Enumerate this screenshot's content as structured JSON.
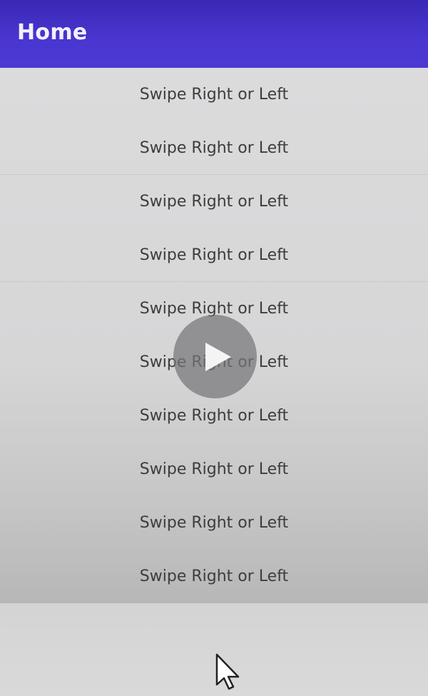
{
  "app_bar": {
    "title": "Home",
    "color": "#4a36d0"
  },
  "list": {
    "items": [
      {
        "label": "Swipe Right or Left"
      },
      {
        "label": "Swipe Right or Left"
      },
      {
        "label": "Swipe Right or Left"
      },
      {
        "label": "Swipe Right or Left"
      },
      {
        "label": "Swipe Right or Left"
      },
      {
        "label": "Swipe Right or Left"
      },
      {
        "label": "Swipe Right or Left"
      },
      {
        "label": "Swipe Right or Left"
      },
      {
        "label": "Swipe Right or Left"
      },
      {
        "label": "Swipe Right or Left"
      }
    ]
  },
  "video_overlay": {
    "icon": "play-icon"
  },
  "pointer": {
    "icon": "cursor-icon"
  }
}
